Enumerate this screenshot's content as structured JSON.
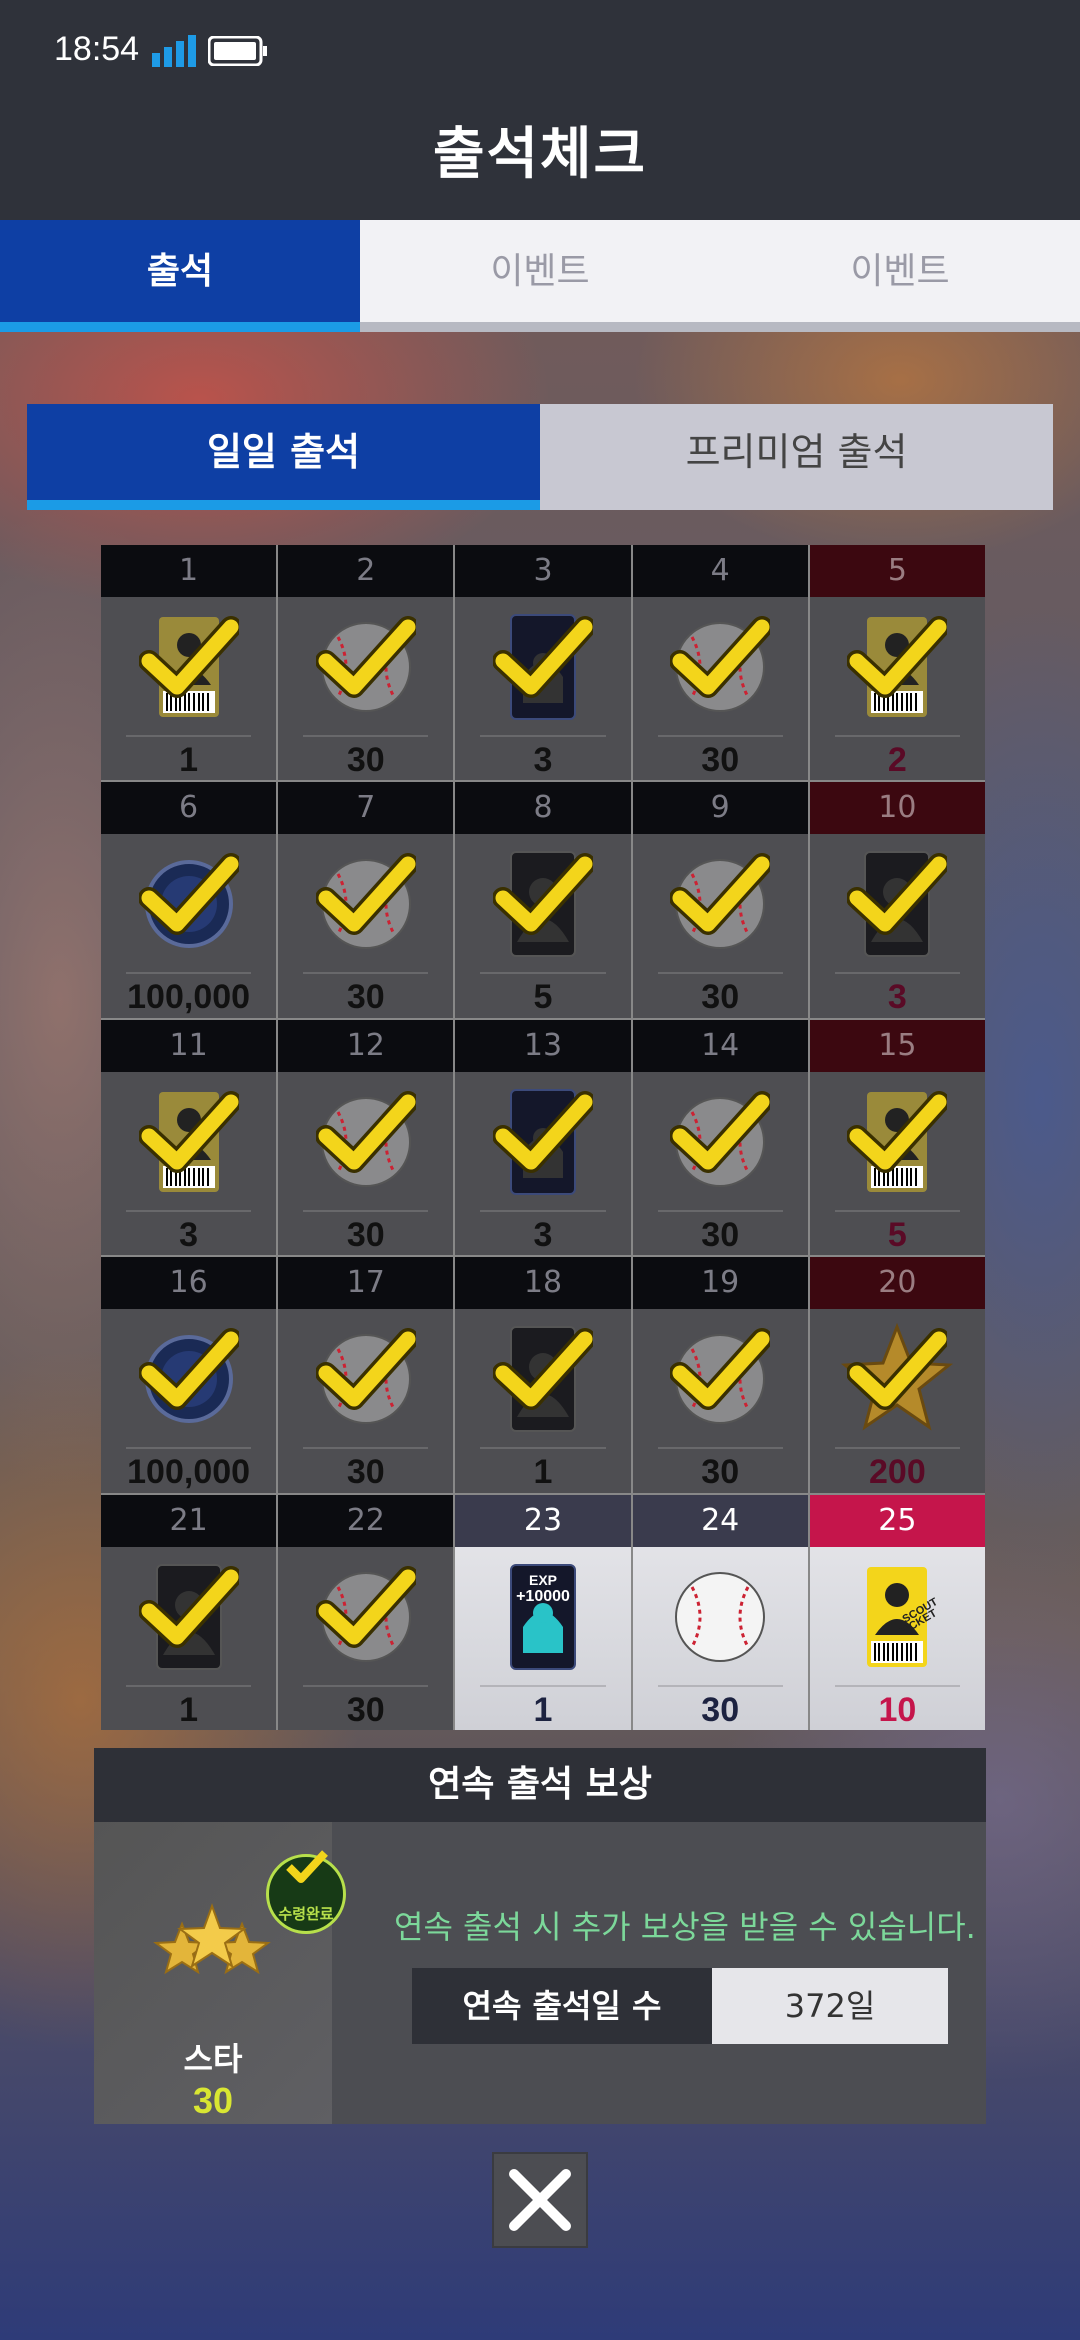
{
  "status_bar": {
    "time": "18:54"
  },
  "header": {
    "title": "출석체크"
  },
  "top_tabs": [
    {
      "label": "출석",
      "active": true
    },
    {
      "label": "이벤트",
      "active": false
    },
    {
      "label": "이벤트",
      "active": false
    }
  ],
  "sub_tabs": [
    {
      "label": "일일 출석",
      "active": true
    },
    {
      "label": "프리미엄 출석",
      "active": false
    }
  ],
  "calendar": [
    {
      "day": "1",
      "reward_icon": "scout-ticket-icon",
      "amount": "1",
      "claimed": true
    },
    {
      "day": "2",
      "reward_icon": "baseball-icon",
      "amount": "30",
      "claimed": true
    },
    {
      "day": "3",
      "reward_icon": "exp-card-icon",
      "amount": "3",
      "claimed": true
    },
    {
      "day": "4",
      "reward_icon": "baseball-icon",
      "amount": "30",
      "claimed": true
    },
    {
      "day": "5",
      "reward_icon": "scout-ticket-icon",
      "amount": "2",
      "claimed": true
    },
    {
      "day": "6",
      "reward_icon": "coin-icon",
      "amount": "100,000",
      "claimed": true
    },
    {
      "day": "7",
      "reward_icon": "baseball-icon",
      "amount": "30",
      "claimed": true
    },
    {
      "day": "8",
      "reward_icon": "player-card-icon",
      "amount": "5",
      "claimed": true
    },
    {
      "day": "9",
      "reward_icon": "baseball-icon",
      "amount": "30",
      "claimed": true
    },
    {
      "day": "10",
      "reward_icon": "player-card-icon",
      "amount": "3",
      "claimed": true
    },
    {
      "day": "11",
      "reward_icon": "scout-ticket-icon",
      "amount": "3",
      "claimed": true
    },
    {
      "day": "12",
      "reward_icon": "baseball-icon",
      "amount": "30",
      "claimed": true
    },
    {
      "day": "13",
      "reward_icon": "exp-card-icon",
      "amount": "3",
      "claimed": true
    },
    {
      "day": "14",
      "reward_icon": "baseball-icon",
      "amount": "30",
      "claimed": true
    },
    {
      "day": "15",
      "reward_icon": "scout-ticket-icon",
      "amount": "5",
      "claimed": true
    },
    {
      "day": "16",
      "reward_icon": "coin-icon",
      "amount": "100,000",
      "claimed": true
    },
    {
      "day": "17",
      "reward_icon": "baseball-icon",
      "amount": "30",
      "claimed": true
    },
    {
      "day": "18",
      "reward_icon": "player-card-icon",
      "amount": "1",
      "claimed": true
    },
    {
      "day": "19",
      "reward_icon": "baseball-icon",
      "amount": "30",
      "claimed": true
    },
    {
      "day": "20",
      "reward_icon": "star-icon",
      "amount": "200",
      "claimed": true
    },
    {
      "day": "21",
      "reward_icon": "player-card-icon",
      "amount": "1",
      "claimed": true
    },
    {
      "day": "22",
      "reward_icon": "baseball-icon",
      "amount": "30",
      "claimed": true
    },
    {
      "day": "23",
      "reward_icon": "exp-card-icon",
      "amount": "1",
      "claimed": false,
      "card_text": {
        "line1": "EXP",
        "line2": "+10000"
      }
    },
    {
      "day": "24",
      "reward_icon": "baseball-icon",
      "amount": "30",
      "claimed": false
    },
    {
      "day": "25",
      "reward_icon": "scout-ticket-icon",
      "amount": "10",
      "claimed": false,
      "card_text": {
        "line1": "SCOUT",
        "line2": "TICKET"
      }
    }
  ],
  "streak_bonus": {
    "title": "연속 출석 보상",
    "reward_name": "스타",
    "reward_amount": "30",
    "stamp_label": "수령완료",
    "description": "연속 출석 시 추가 보상을 받을 수 있습니다.",
    "counter_label": "연속 출석일 수",
    "counter_value": "372일"
  },
  "colors": {
    "primary_blue": "#0e3fa4",
    "accent_cyan": "#1b9be6",
    "weekly_red": "#c5154b",
    "check_yellow": "#f3d51b",
    "bonus_green": "#7cd89a"
  }
}
